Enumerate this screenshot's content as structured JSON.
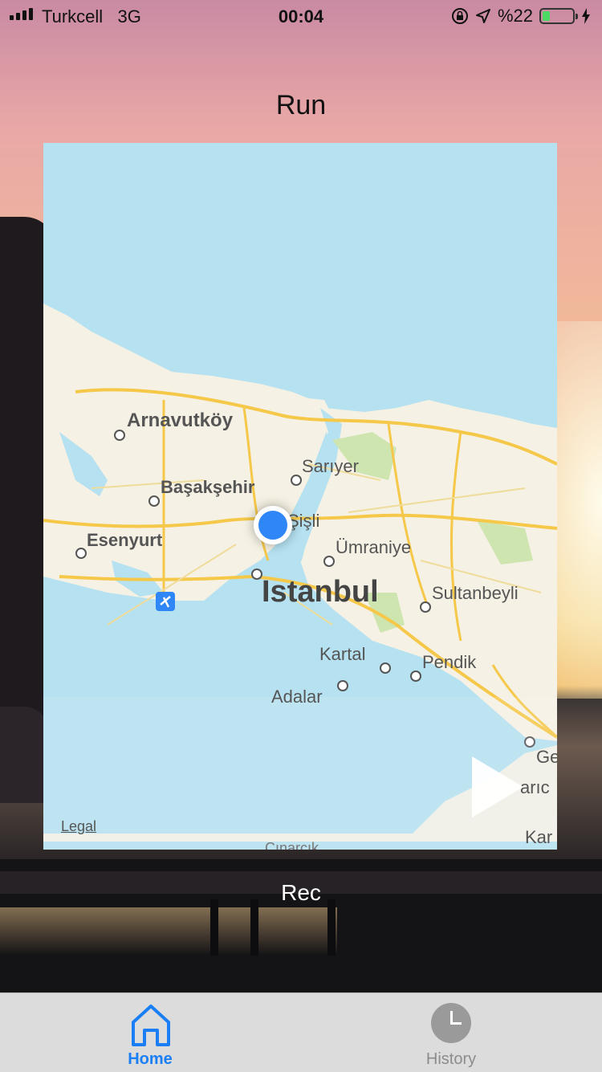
{
  "status_bar": {
    "carrier": "Turkcell",
    "network": "3G",
    "time": "00:04",
    "battery_percent": "%22",
    "battery_level": 0.22,
    "icons": [
      "signal-icon",
      "orientation-lock-icon",
      "location-arrow-icon",
      "battery-icon",
      "charging-bolt-icon"
    ]
  },
  "header": {
    "title": "Run"
  },
  "map": {
    "legal_label": "Legal",
    "labels": {
      "arnavutkoy": "Arnavutköy",
      "sariyer": "Sarıyer",
      "basaksehir": "Başakşehir",
      "sisli": "Şişli",
      "esenyurt": "Esenyurt",
      "umraniye": "Ümraniye",
      "istanbul": "Istanbul",
      "sultanbeyli": "Sultanbeyli",
      "kartal": "Kartal",
      "pendik": "Pendik",
      "adalar": "Adalar",
      "ge": "Ge",
      "daric": "arıc",
      "kar": "Kar",
      "cinarcik": "Çınarcık"
    }
  },
  "controls": {
    "rec_label": "Rec"
  },
  "tabbar": {
    "home_label": "Home",
    "history_label": "History",
    "active_color": "#1a7ff5",
    "inactive_color": "#8c8c8c"
  }
}
